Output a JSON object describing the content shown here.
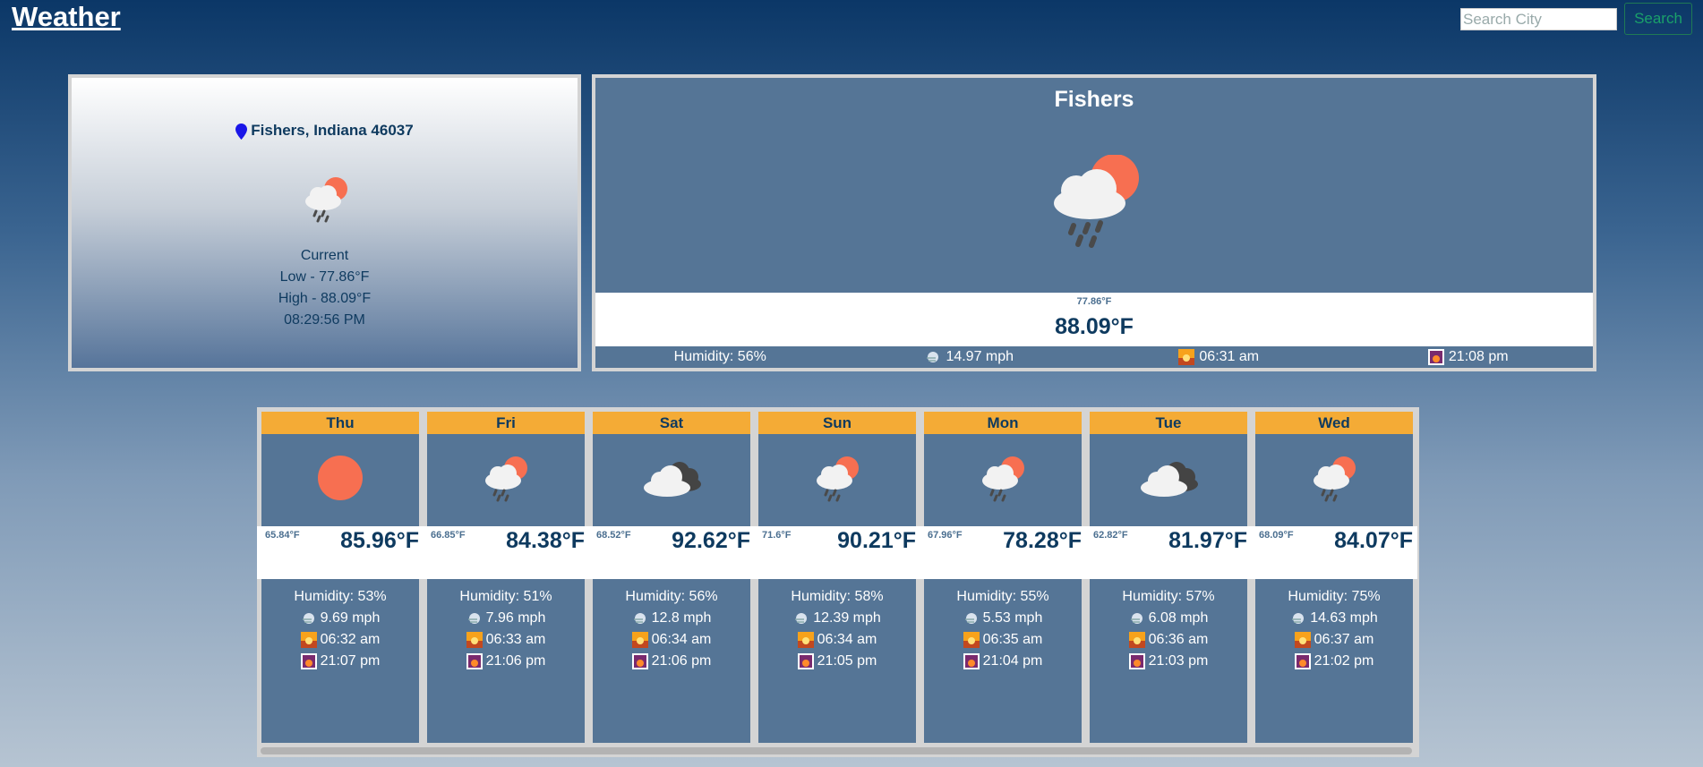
{
  "header": {
    "brand": "Weather",
    "search_placeholder": "Search City",
    "search_label": "Search"
  },
  "current": {
    "location": "Fishers, Indiana 46037",
    "label": "Current",
    "low": "Low - 77.86°F",
    "high": "High - 88.09°F",
    "time": "08:29:56 PM",
    "icon": "partly-cloudy-rain-icon"
  },
  "today": {
    "city": "Fishers",
    "icon": "partly-cloudy-rain-icon",
    "low": "77.86°F",
    "high": "88.09°F",
    "humidity": "Humidity: 56%",
    "wind": "14.97 mph",
    "sunrise": "06:31 am",
    "sunset": "21:08 pm"
  },
  "forecast": [
    {
      "day": "Thu",
      "icon": "sun-icon",
      "low": "65.84°F",
      "high": "85.96°F",
      "humidity": "Humidity: 53%",
      "wind": "9.69 mph",
      "sunrise": "06:32 am",
      "sunset": "21:07 pm"
    },
    {
      "day": "Fri",
      "icon": "partly-cloudy-rain-icon",
      "low": "66.85°F",
      "high": "84.38°F",
      "humidity": "Humidity: 51%",
      "wind": "7.96 mph",
      "sunrise": "06:33 am",
      "sunset": "21:06 pm"
    },
    {
      "day": "Sat",
      "icon": "cloudy-icon",
      "low": "68.52°F",
      "high": "92.62°F",
      "humidity": "Humidity: 56%",
      "wind": "12.8 mph",
      "sunrise": "06:34 am",
      "sunset": "21:06 pm"
    },
    {
      "day": "Sun",
      "icon": "partly-cloudy-rain-icon",
      "low": "71.6°F",
      "high": "90.21°F",
      "humidity": "Humidity: 58%",
      "wind": "12.39 mph",
      "sunrise": "06:34 am",
      "sunset": "21:05 pm"
    },
    {
      "day": "Mon",
      "icon": "partly-cloudy-rain-icon",
      "low": "67.96°F",
      "high": "78.28°F",
      "humidity": "Humidity: 55%",
      "wind": "5.53 mph",
      "sunrise": "06:35 am",
      "sunset": "21:04 pm"
    },
    {
      "day": "Tue",
      "icon": "cloudy-icon",
      "low": "62.82°F",
      "high": "81.97°F",
      "humidity": "Humidity: 57%",
      "wind": "6.08 mph",
      "sunrise": "06:36 am",
      "sunset": "21:03 pm"
    },
    {
      "day": "Wed",
      "icon": "partly-cloudy-rain-icon",
      "low": "68.09°F",
      "high": "84.07°F",
      "humidity": "Humidity: 75%",
      "wind": "14.63 mph",
      "sunrise": "06:37 am",
      "sunset": "21:02 pm"
    }
  ],
  "colors": {
    "accent": "#f4ab36",
    "panel": "#557596",
    "text_dark": "#0e3a5f",
    "sun": "#f76f51"
  }
}
